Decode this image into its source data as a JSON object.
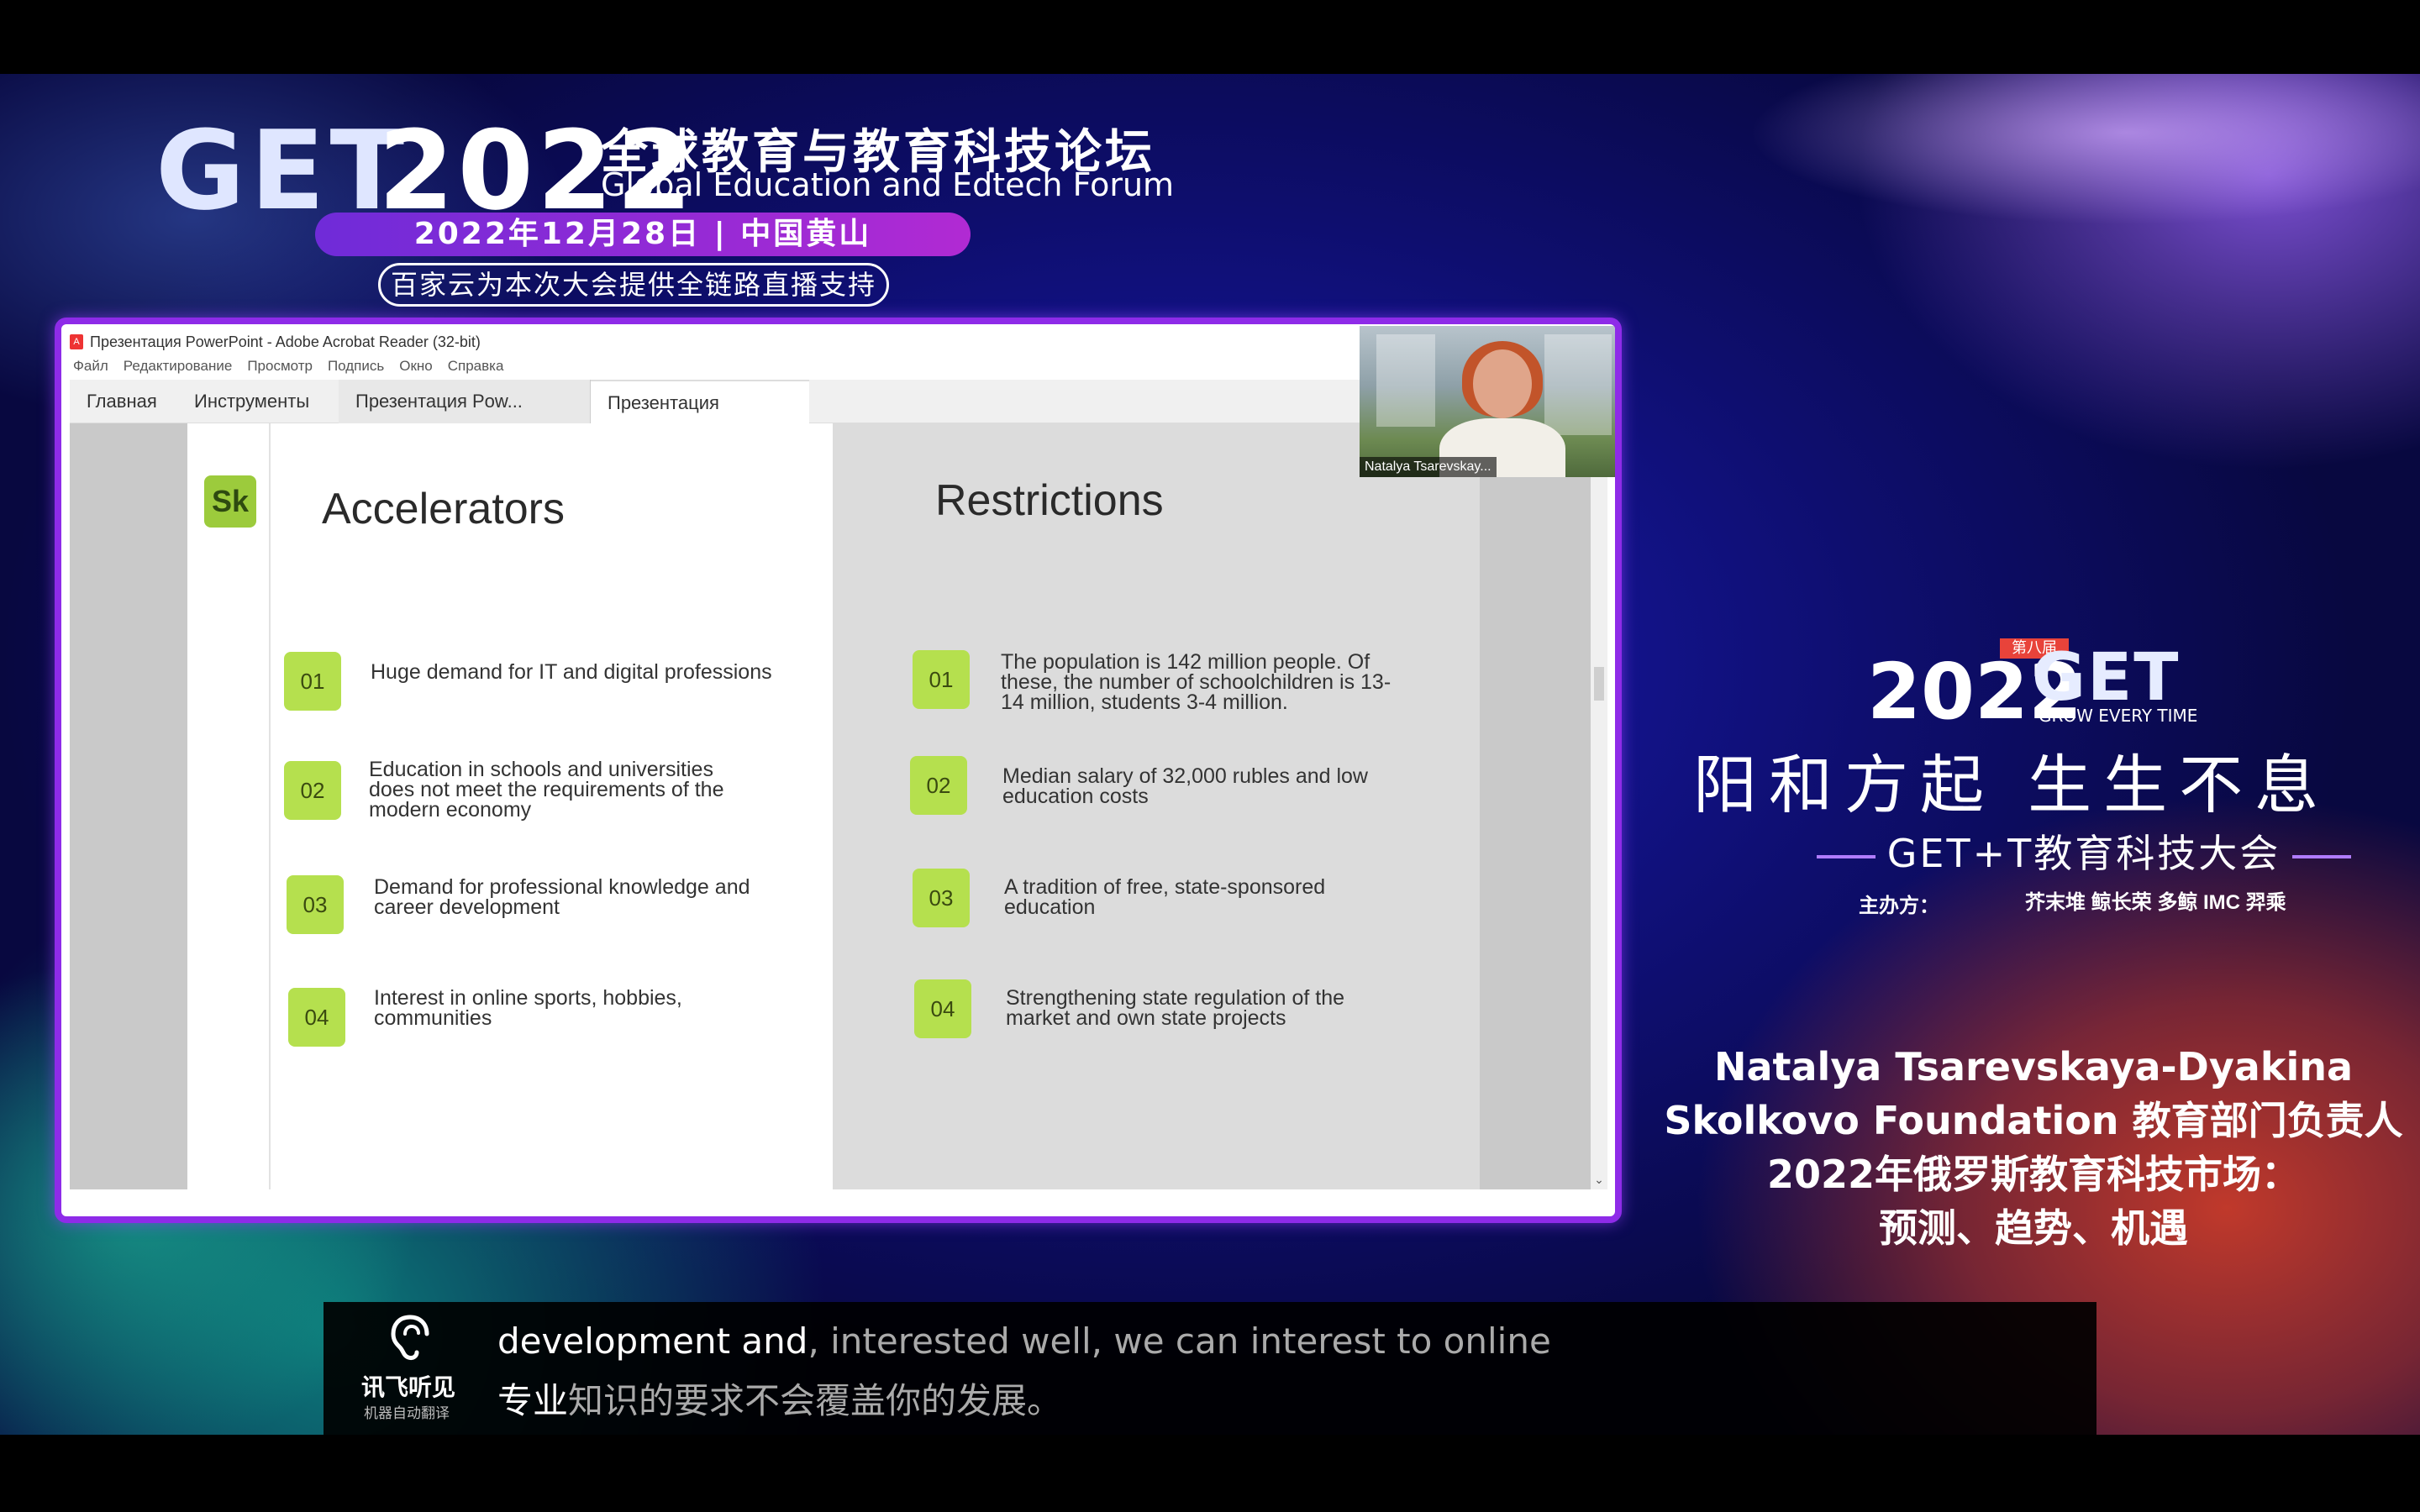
{
  "header": {
    "logo_letters": "GET",
    "logo_year": "2022",
    "forum_cn": "全球教育与教育科技论坛",
    "forum_en": "Global Education and Edtech Forum",
    "date_location": "2022年12月28日 | 中国黄山",
    "support_note": "百家云为本次大会提供全链路直播支持"
  },
  "acrobat": {
    "window_title": "Презентация PowerPoint - Adobe Acrobat Reader (32-bit)",
    "menu": [
      "Файл",
      "Редактирование",
      "Просмотр",
      "Подпись",
      "Окно",
      "Справка"
    ],
    "tabs": {
      "home": "Главная",
      "tools": "Инструменты",
      "doc1": "Презентация Pow...",
      "doc2": "Презентация Pow...",
      "close": "×"
    },
    "scroll_down": "⌄"
  },
  "slide": {
    "logo": "Sk",
    "left_title": "Accelerators",
    "right_title": "Restrictions",
    "accelerators": [
      {
        "num": "01",
        "text": "Huge demand for IT and digital professions"
      },
      {
        "num": "02",
        "text": "Education in schools and universities does not meet the requirements of the modern economy"
      },
      {
        "num": "03",
        "text": "Demand for professional knowledge and career development"
      },
      {
        "num": "04",
        "text": "Interest in online sports, hobbies, communities"
      }
    ],
    "restrictions": [
      {
        "num": "01",
        "text": "The population is 142 million people. Of these, the number of schoolchildren is 13-14 million, students 3-4 million."
      },
      {
        "num": "02",
        "text": "Median salary of 32,000 rubles and low education costs"
      },
      {
        "num": "03",
        "text": "A tradition of free, state-sponsored education"
      },
      {
        "num": "04",
        "text": "Strengthening state regulation of the market and own state projects"
      }
    ]
  },
  "webcam": {
    "name": "Natalya Tsarevskay..."
  },
  "brand": {
    "edition_badge": "第八届",
    "year": "2022",
    "get": "GET",
    "tagline": "GROW EVERY TIME",
    "slogan": "阳和方起  生生不息",
    "conference": "GET+T教育科技大会",
    "hosts_label": "主办方：",
    "hosts": "芥末堆 鲸长荣 多鲸 IMC 羿乘"
  },
  "speaker": {
    "name": "Natalya Tsarevskaya-Dyakina",
    "role": "Skolkovo Foundation 教育部门负责人",
    "topic_line1": "2022年俄罗斯教育科技市场：",
    "topic_line2": "预测、趋势、机遇"
  },
  "subtitles": {
    "brand": "讯飞听见",
    "brand_sub": "机器自动翻译",
    "en_highlight": "development and",
    "en_rest": ", interested well, we can interest to online",
    "cn_highlight": "专业",
    "cn_rest": "知识的要求不会覆盖你的发展。"
  }
}
